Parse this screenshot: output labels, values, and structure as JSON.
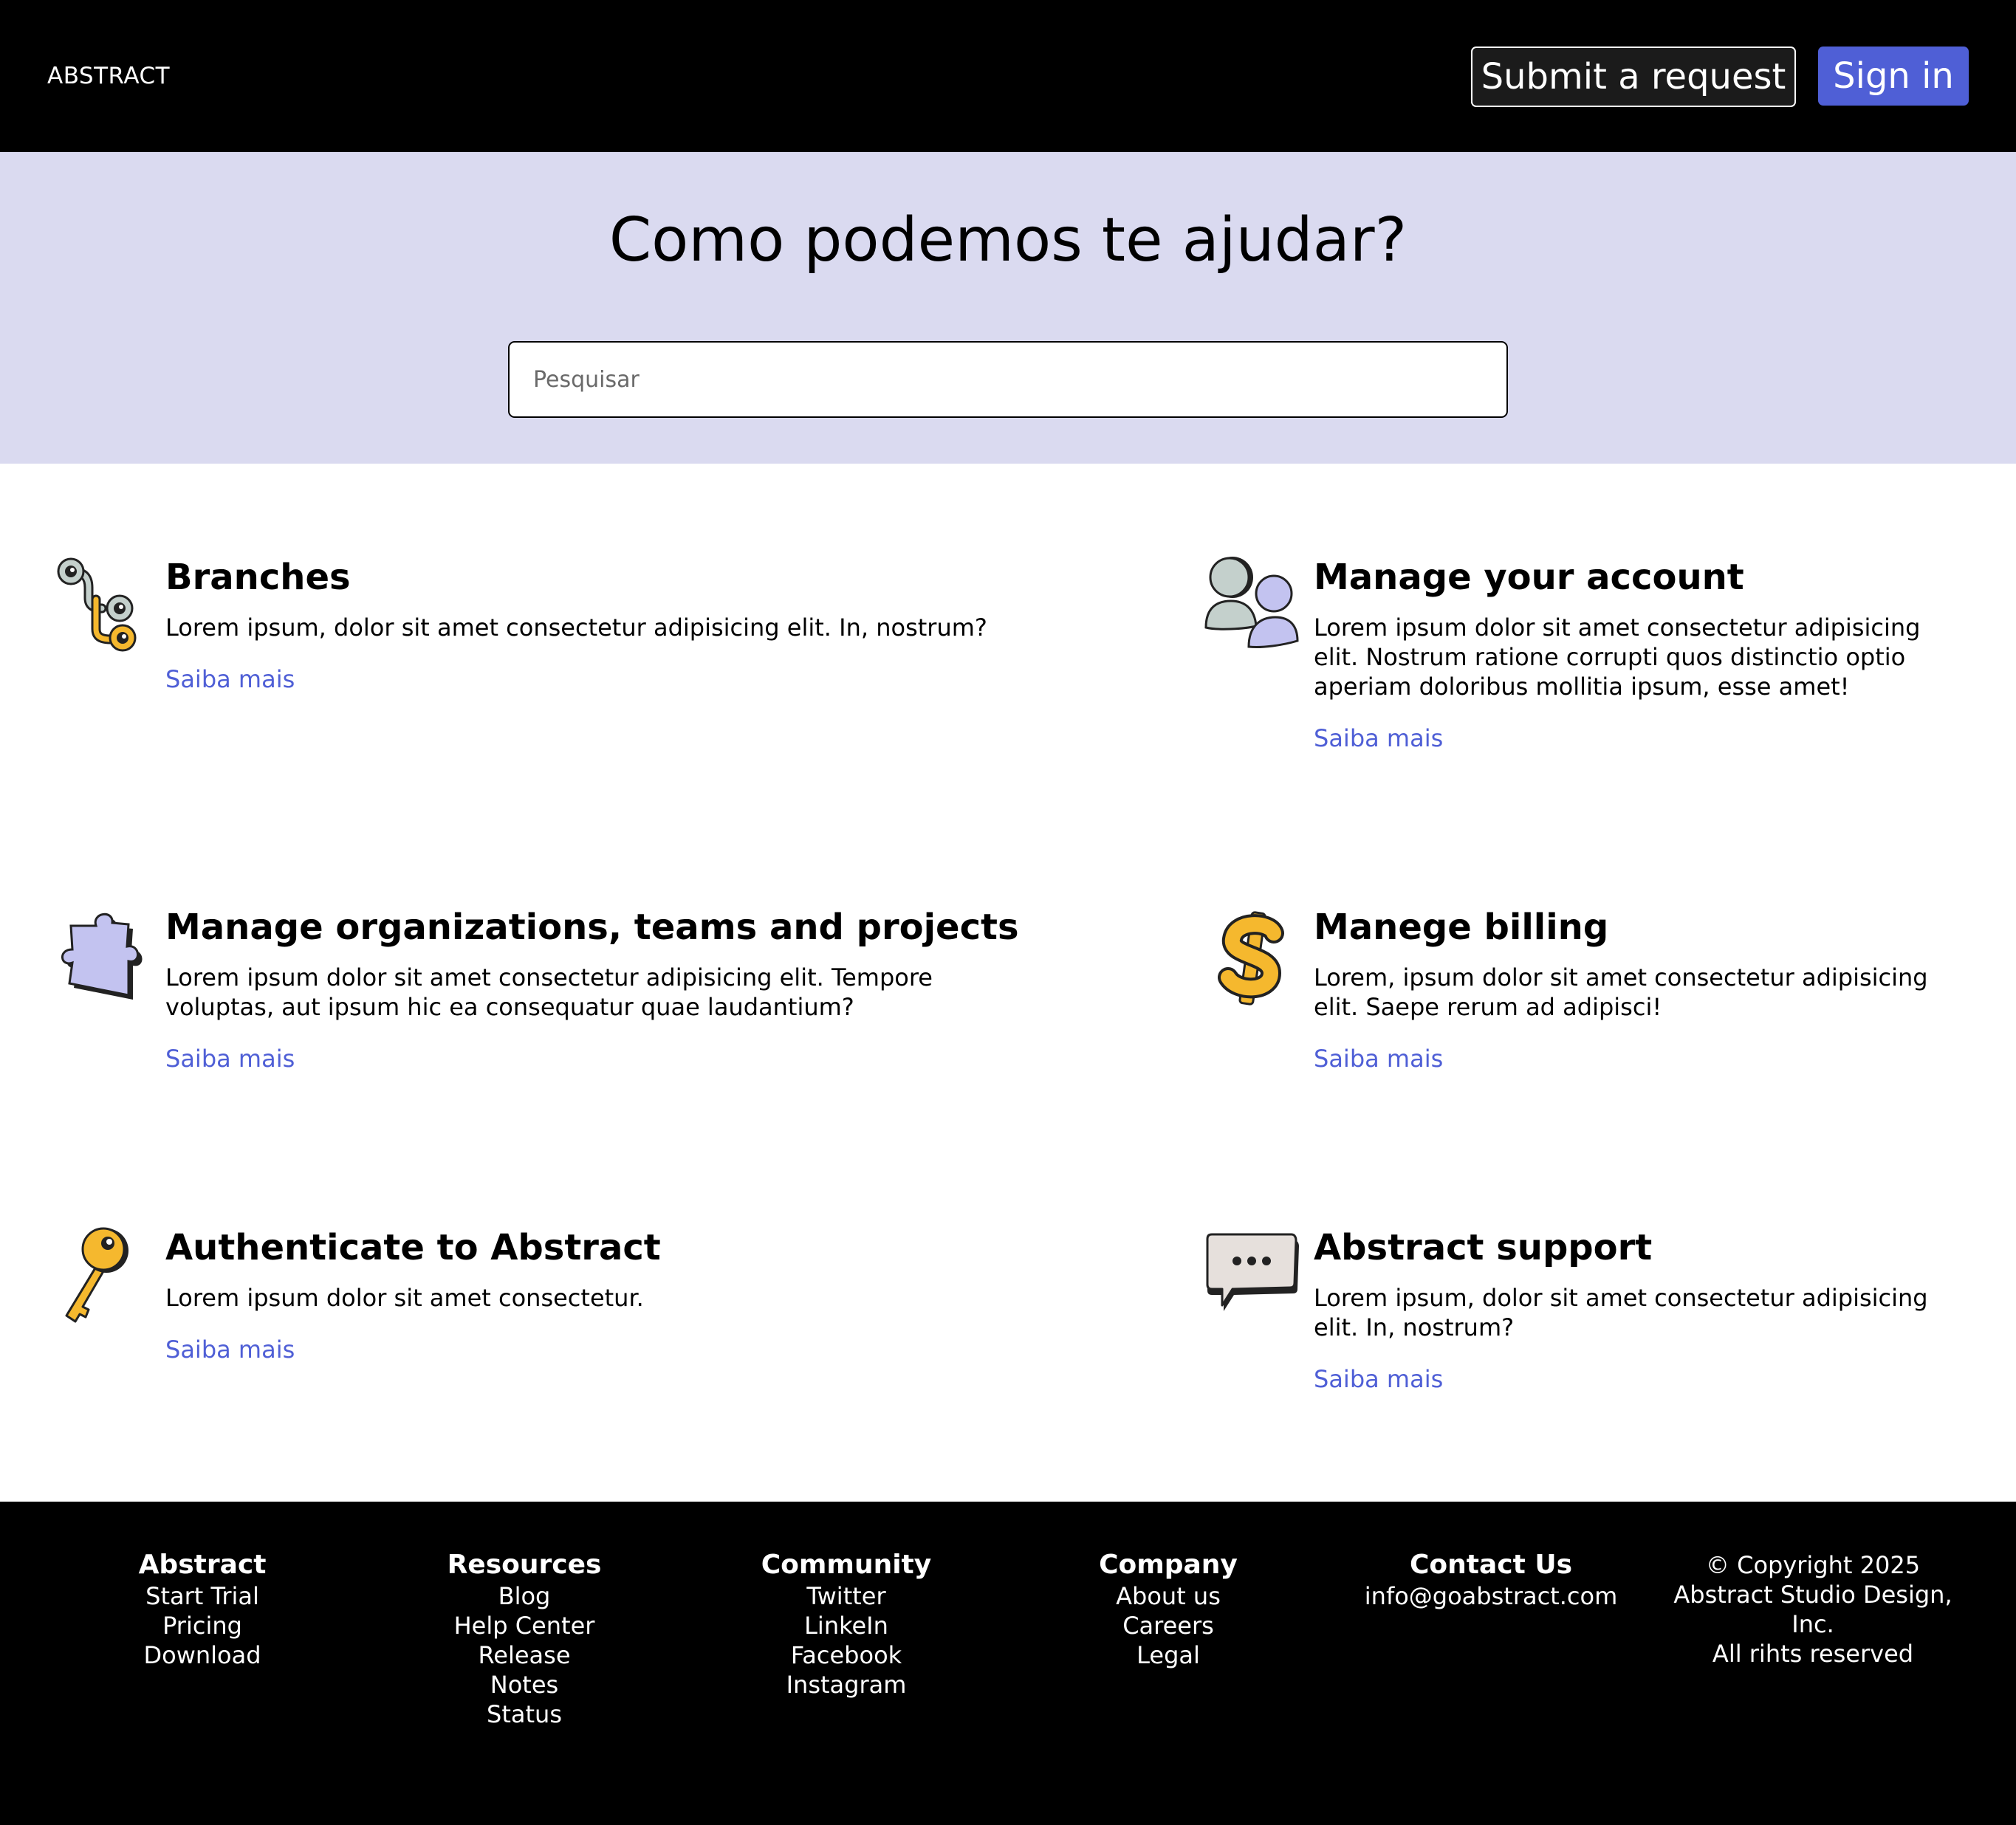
{
  "header": {
    "brand": "ABSTRACT",
    "submit_label": "Submit a request",
    "signin_label": "Sign in"
  },
  "hero": {
    "title": "Como podemos te ajudar?",
    "search_placeholder": "Pesquisar"
  },
  "cards": [
    {
      "icon": "branches-icon",
      "title": "Branches",
      "description": "Lorem ipsum, dolor sit amet consectetur adipisicing elit. In, nostrum?",
      "link": "Saiba mais"
    },
    {
      "icon": "users-icon",
      "title": "Manage your account",
      "description": "Lorem ipsum dolor sit amet consectetur adipisicing elit. Nostrum ratione corrupti quos distinctio optio aperiam doloribus mollitia ipsum, esse amet!",
      "link": "Saiba mais"
    },
    {
      "icon": "puzzle-icon",
      "title": "Manage organizations, teams and projects",
      "description": "Lorem ipsum dolor sit amet consectetur adipisicing elit. Tempore voluptas, aut ipsum hic ea consequatur quae laudantium?",
      "link": "Saiba mais"
    },
    {
      "icon": "dollar-icon",
      "title": "Manege billing",
      "description": "Lorem, ipsum dolor sit amet consectetur adipisicing elit. Saepe rerum ad adipisci!",
      "link": "Saiba mais"
    },
    {
      "icon": "key-icon",
      "title": "Authenticate to Abstract",
      "description": "Lorem ipsum dolor sit amet consectetur.",
      "link": "Saiba mais"
    },
    {
      "icon": "chat-bubble-icon",
      "title": "Abstract support",
      "description": "Lorem ipsum, dolor sit amet consectetur adipisicing elit. In, nostrum?",
      "link": "Saiba mais"
    }
  ],
  "footer": {
    "columns": [
      {
        "heading": "Abstract",
        "links": [
          "Start Trial",
          "Pricing",
          "Download"
        ]
      },
      {
        "heading": "Resources",
        "links": [
          "Blog",
          "Help Center",
          "Release",
          "Notes",
          "Status"
        ]
      },
      {
        "heading": "Community",
        "links": [
          "Twitter",
          "LinkeIn",
          "Facebook",
          "Instagram"
        ]
      },
      {
        "heading": "Company",
        "links": [
          "About us",
          "Careers",
          "Legal"
        ]
      },
      {
        "heading": "Contact Us",
        "links": [
          "info@goabstract.com"
        ]
      }
    ],
    "copyright_lines": [
      "© Copyright 2025",
      "Abstract Studio Design,",
      "Inc.",
      "All rihts reserved"
    ]
  },
  "colors": {
    "header_bg": "#000000",
    "hero_bg": "#dadaf0",
    "accent": "#4f5fd6",
    "link": "#4f5fd6",
    "footer_bg": "#000000",
    "icon_yellow": "#f5b82e",
    "icon_lavender": "#c3c3f0",
    "icon_gray": "#c4d0cc"
  }
}
